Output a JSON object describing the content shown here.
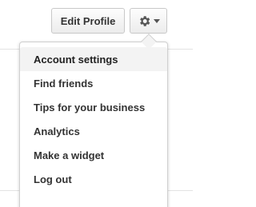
{
  "header": {
    "edit_profile_label": "Edit Profile",
    "settings_icon": "gear-icon",
    "dropdown_icon": "caret-down-icon"
  },
  "menu": {
    "items": [
      {
        "label": "Account settings",
        "active": true
      },
      {
        "label": "Find friends"
      },
      {
        "label": "Tips for your business"
      },
      {
        "label": "Analytics"
      },
      {
        "label": "Make a widget"
      },
      {
        "label": "Log out"
      }
    ]
  },
  "colors": {
    "text": "#333333",
    "hover_bg": "#f3f3f3",
    "border": "#d0d0d0"
  }
}
